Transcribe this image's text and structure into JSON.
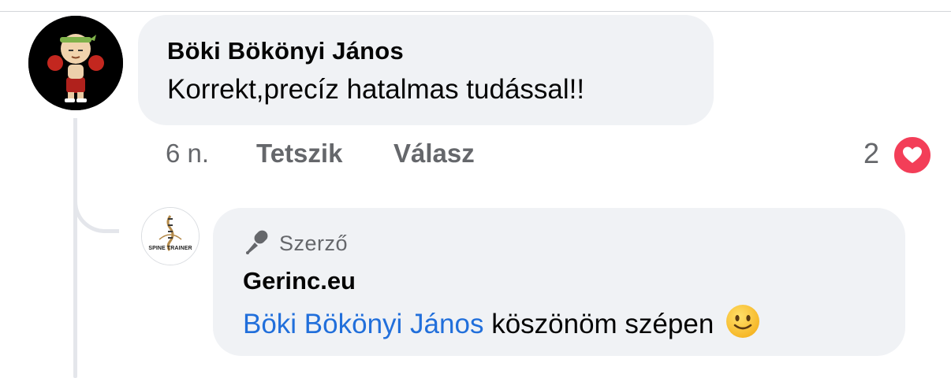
{
  "comment": {
    "author": "Böki Bökönyi János",
    "text": "Korrekt,precíz hatalmas tudással!!",
    "avatar_icon": "cartoon-boxer-avatar",
    "time": "6 n.",
    "like_label": "Tetszik",
    "reply_label": "Válasz",
    "reaction_count": "2",
    "reaction_icon": "heart-icon"
  },
  "reply": {
    "author_badge": "Szerző",
    "badge_icon": "microphone-icon",
    "author": "Gerinc.eu",
    "avatar_icon": "spine-trainer-logo",
    "logo_text": "SPINE TRAINER",
    "mention": "Böki Bökönyi János",
    "text": "köszönöm szépen",
    "emoji": "slightly-smiling-face-emoji"
  },
  "colors": {
    "bubble_bg": "#f0f2f5",
    "secondary_text": "#65676b",
    "mention": "#216fdb",
    "heart": "#f33e58"
  }
}
